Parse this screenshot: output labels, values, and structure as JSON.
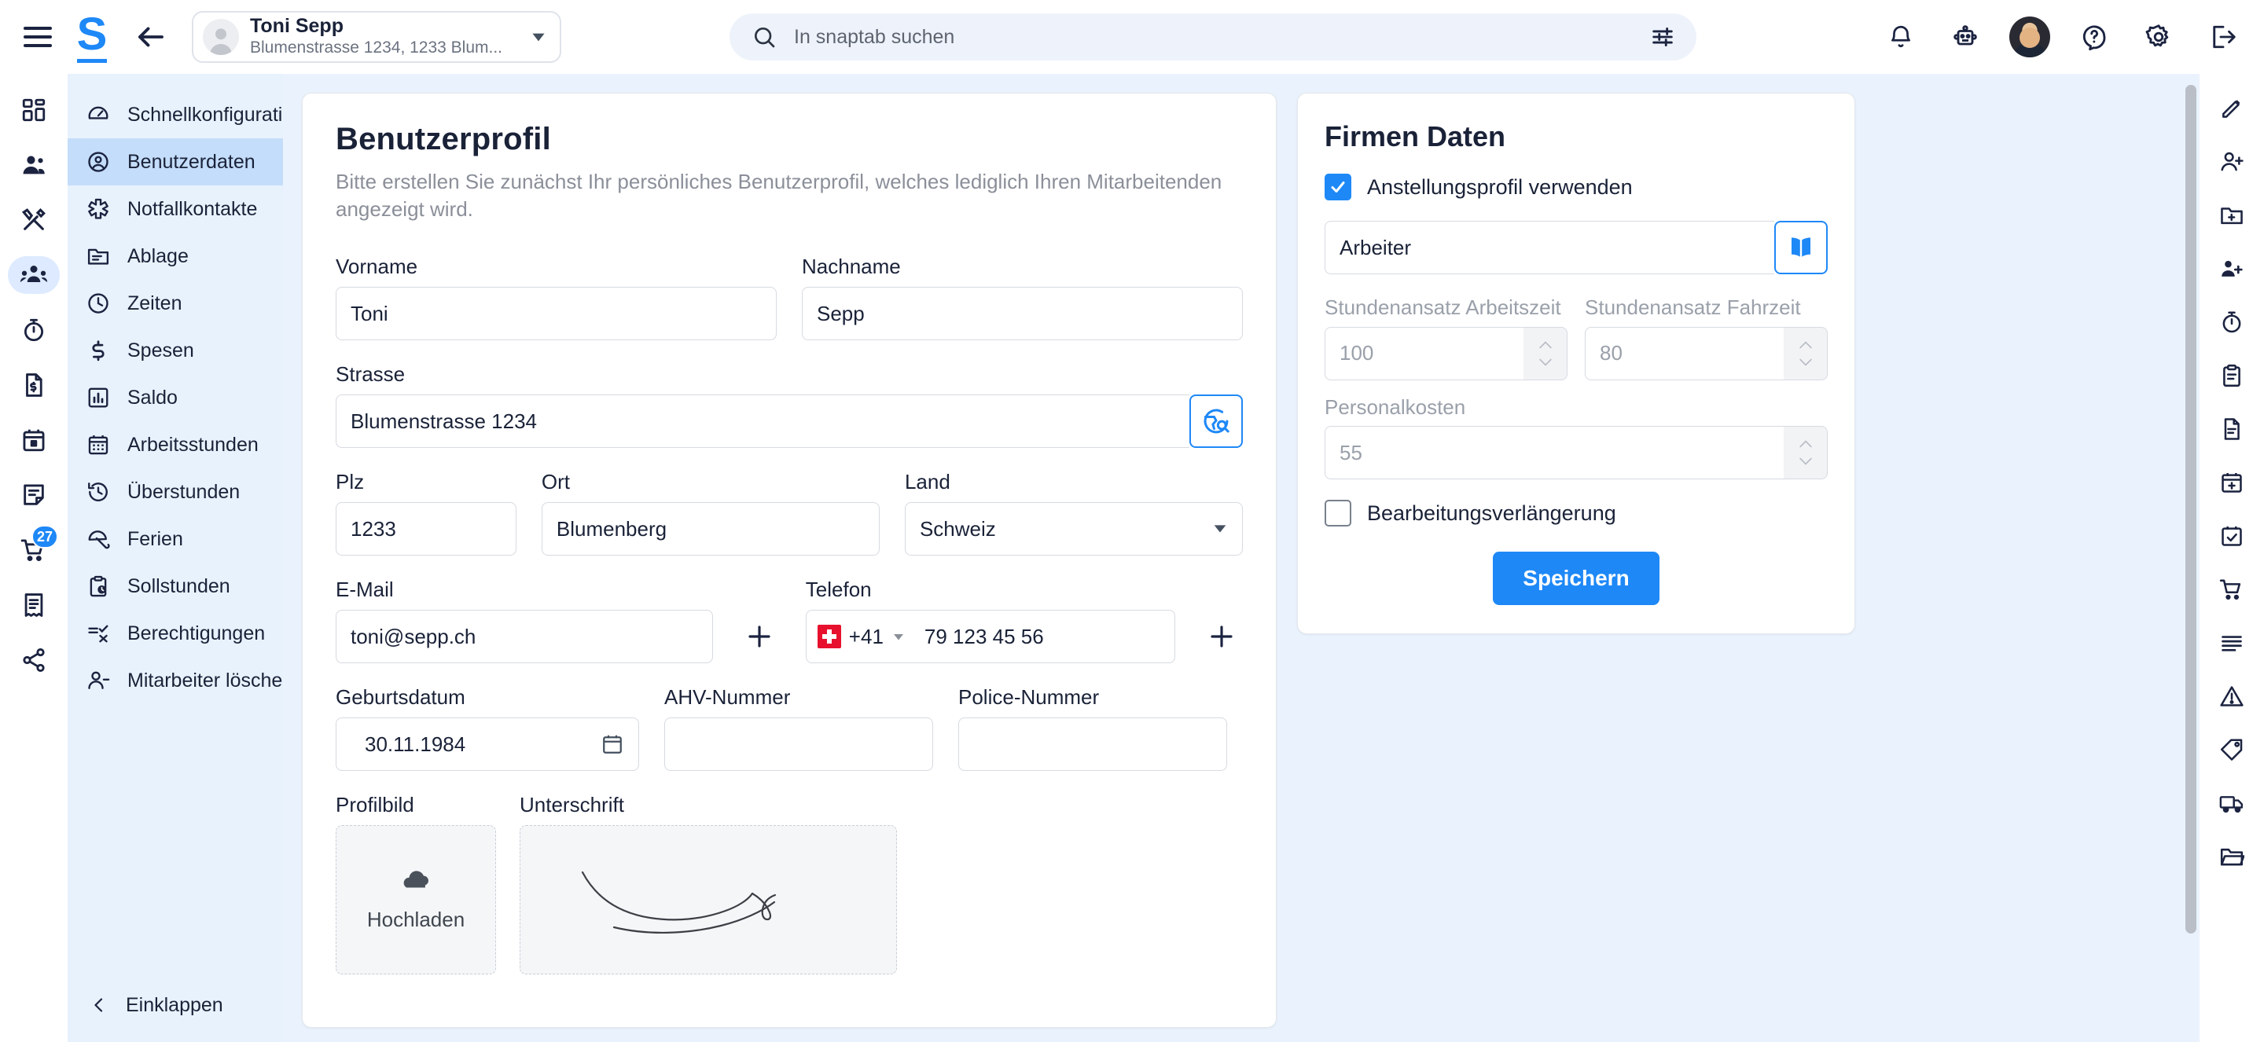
{
  "topbar": {
    "menu_icon": "hamburger-menu-icon",
    "logo": "S",
    "back_icon": "back-arrow-icon",
    "user_chip": {
      "name": "Toni Sepp",
      "subtitle": "Blumenstrasse 1234, 1233 Blum...",
      "caret": "chevron-down-icon"
    },
    "search": {
      "placeholder": "In snaptab suchen",
      "icon": "search-icon",
      "filter_icon": "tune-filter-icon"
    },
    "icons": [
      {
        "name": "notifications-bell-icon"
      },
      {
        "name": "robot-assistant-icon"
      },
      {
        "name": "user-avatar"
      },
      {
        "name": "help-question-icon"
      },
      {
        "name": "settings-gear-icon"
      },
      {
        "name": "logout-icon"
      }
    ]
  },
  "rail": {
    "items": [
      {
        "name": "dashboard-icon",
        "active": false
      },
      {
        "name": "contacts-icon",
        "active": false
      },
      {
        "name": "tools-icon",
        "active": false
      },
      {
        "name": "employees-icon",
        "active": true
      },
      {
        "name": "stopwatch-icon",
        "active": false
      },
      {
        "name": "invoice-icon",
        "active": false
      },
      {
        "name": "calendar-icon",
        "active": false
      },
      {
        "name": "notes-icon",
        "active": false
      },
      {
        "name": "cart-icon",
        "active": false,
        "badge": "27"
      },
      {
        "name": "receipt-icon",
        "active": false
      },
      {
        "name": "share-icon",
        "active": false
      }
    ]
  },
  "subnav": {
    "items": [
      {
        "label": "Schnellkonfiguration",
        "icon": "speedometer-icon",
        "active": false
      },
      {
        "label": "Benutzerdaten",
        "icon": "account-circle-icon",
        "active": true
      },
      {
        "label": "Notfallkontakte",
        "icon": "medical-star-icon",
        "active": false
      },
      {
        "label": "Ablage",
        "icon": "folder-icon",
        "active": false
      },
      {
        "label": "Zeiten",
        "icon": "clock-icon",
        "active": false
      },
      {
        "label": "Spesen",
        "icon": "dollar-icon",
        "active": false
      },
      {
        "label": "Saldo",
        "icon": "bar-chart-icon",
        "active": false
      },
      {
        "label": "Arbeitsstunden",
        "icon": "calendar-grid-icon",
        "active": false
      },
      {
        "label": "Überstunden",
        "icon": "history-icon",
        "active": false
      },
      {
        "label": "Ferien",
        "icon": "umbrella-icon",
        "active": false
      },
      {
        "label": "Sollstunden",
        "icon": "clipboard-clock-icon",
        "active": false
      },
      {
        "label": "Berechtigungen",
        "icon": "permissions-icon",
        "active": false
      },
      {
        "label": "Mitarbeiter löschen",
        "icon": "person-remove-icon",
        "active": false
      }
    ],
    "collapse": {
      "label": "Einklappen",
      "icon": "chevron-left-icon"
    }
  },
  "profile": {
    "title": "Benutzerprofil",
    "subtitle": "Bitte erstellen Sie zunächst Ihr persönliches Benutzerprofil, welches lediglich Ihren Mitarbeitenden angezeigt wird.",
    "fields": {
      "vorname": {
        "label": "Vorname",
        "value": "Toni"
      },
      "nachname": {
        "label": "Nachname",
        "value": "Sepp"
      },
      "strasse": {
        "label": "Strasse",
        "value": "Blumenstrasse 1234",
        "button_icon": "map-search-icon"
      },
      "plz": {
        "label": "Plz",
        "value": "1233"
      },
      "ort": {
        "label": "Ort",
        "value": "Blumenberg"
      },
      "land": {
        "label": "Land",
        "value": "Schweiz",
        "caret": "chevron-down-icon"
      },
      "email": {
        "label": "E-Mail",
        "value": "toni@sepp.ch",
        "add_icon": "plus-icon"
      },
      "telefon": {
        "label": "Telefon",
        "country_code": "+41",
        "flag": "swiss-flag-icon",
        "value": "79 123 45 56",
        "add_icon": "plus-icon",
        "caret": "chevron-down-icon"
      },
      "geburtsdatum": {
        "label": "Geburtsdatum",
        "value": "30.11.1984",
        "icon": "calendar-picker-icon"
      },
      "ahv": {
        "label": "AHV-Nummer",
        "value": ""
      },
      "police": {
        "label": "Police-Nummer",
        "value": ""
      },
      "profilbild": {
        "label": "Profilbild",
        "upload_label": "Hochladen",
        "icon": "cloud-upload-icon"
      },
      "unterschrift": {
        "label": "Unterschrift",
        "icon": "signature-scribble"
      }
    }
  },
  "company": {
    "title": "Firmen Daten",
    "use_profile": {
      "label": "Anstellungsprofil verwenden",
      "checked": true
    },
    "profile_select": {
      "value": "Arbeiter",
      "button_icon": "book-icon"
    },
    "stundenansatz_arbeitszeit": {
      "label": "Stundenansatz Arbeitszeit",
      "value": "100"
    },
    "stundenansatz_fahrzeit": {
      "label": "Stundenansatz Fahrzeit",
      "value": "80"
    },
    "personalkosten": {
      "label": "Personalkosten",
      "value": "55"
    },
    "bearbeitungsverlaengerung": {
      "label": "Bearbeitungsverlängerung",
      "checked": false
    },
    "save_label": "Speichern"
  },
  "right_rail": {
    "items": [
      {
        "name": "edit-pencil-icon"
      },
      {
        "name": "add-person-icon"
      },
      {
        "name": "folder-add-icon"
      },
      {
        "name": "group-add-icon"
      },
      {
        "name": "timer-icon"
      },
      {
        "name": "clipboard-paste-icon"
      },
      {
        "name": "document-icon"
      },
      {
        "name": "calendar-add-icon"
      },
      {
        "name": "task-check-icon"
      },
      {
        "name": "cart-add-icon"
      },
      {
        "name": "list-icon"
      },
      {
        "name": "warning-triangle-icon"
      },
      {
        "name": "tag-icon"
      },
      {
        "name": "truck-icon"
      },
      {
        "name": "folder-open-icon"
      }
    ]
  },
  "colors": {
    "accent": "#1e88f7",
    "nav_bg": "#e8f2fd",
    "nav_active": "#c4ddfa",
    "content_bg": "#eaf3fd",
    "badge": "#1e88f7",
    "flag_red": "#e8112d"
  }
}
